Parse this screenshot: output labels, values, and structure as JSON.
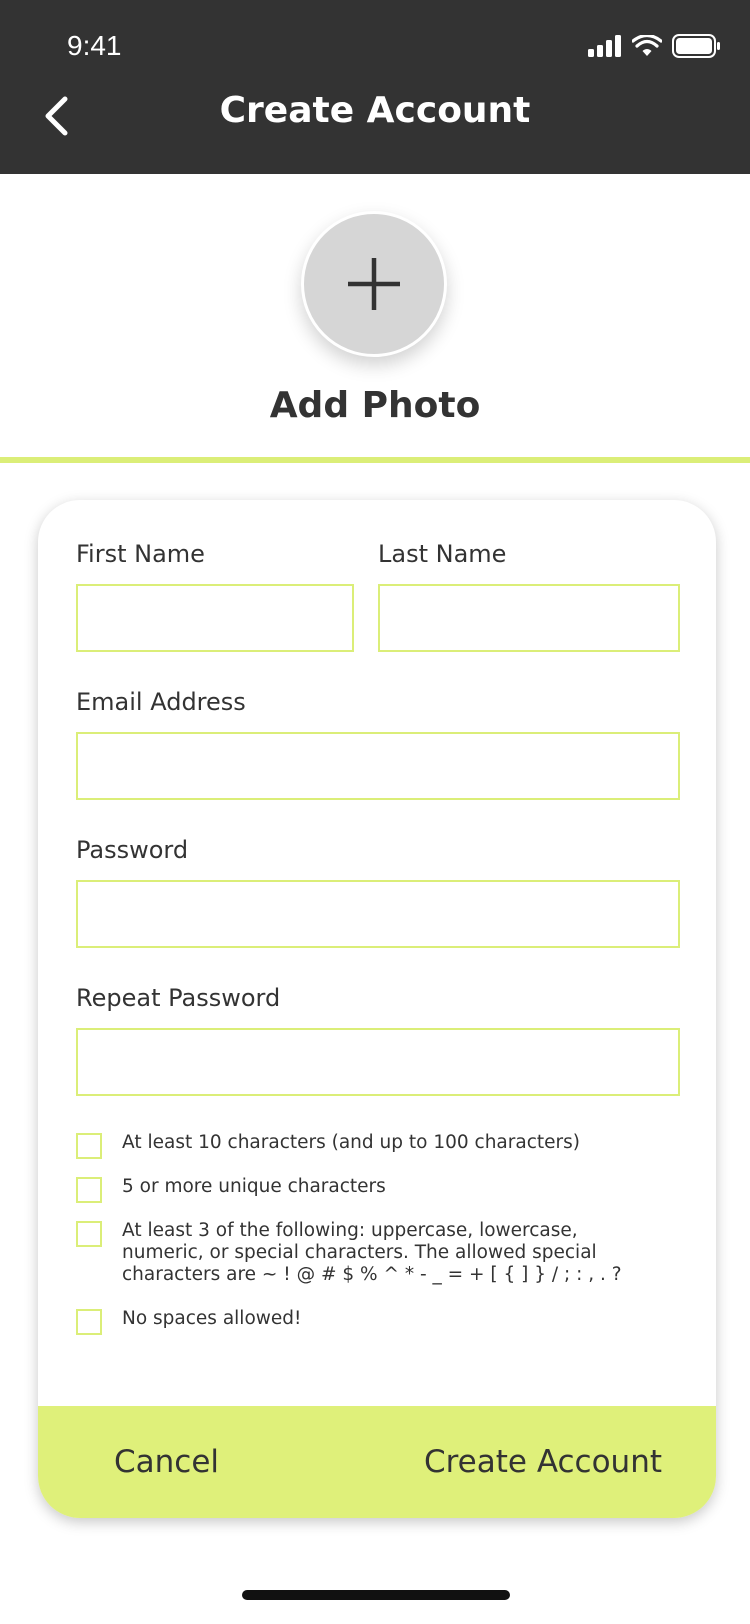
{
  "status_bar": {
    "time": "9:41"
  },
  "header": {
    "title": "Create Account"
  },
  "photo": {
    "label": "Add Photo"
  },
  "form": {
    "first_name": {
      "label": "First Name",
      "value": "",
      "placeholder": ""
    },
    "last_name": {
      "label": "Last Name",
      "value": "",
      "placeholder": ""
    },
    "email": {
      "label": "Email Address",
      "value": "",
      "placeholder": ""
    },
    "password": {
      "label": "Password",
      "value": "",
      "placeholder": ""
    },
    "repeat_password": {
      "label": "Repeat Password",
      "value": "",
      "placeholder": ""
    }
  },
  "rules": [
    {
      "text": "At least 10 characters (and up to 100 characters)",
      "checked": false
    },
    {
      "text": "5 or more unique characters",
      "checked": false
    },
    {
      "text": "At least 3 of the following: uppercase, lowercase, numeric, or special characters. The allowed special characters are ~ ! @ # $ % ^ * - _ = + [ { ] } / ; : , . ?",
      "checked": false
    },
    {
      "text": "No spaces allowed!",
      "checked": false
    }
  ],
  "actions": {
    "cancel": "Cancel",
    "create": "Create Account"
  },
  "colors": {
    "header_bg": "#333333",
    "accent": "#dbee78",
    "bottom_bar": "#dff07a",
    "text": "#333333"
  }
}
